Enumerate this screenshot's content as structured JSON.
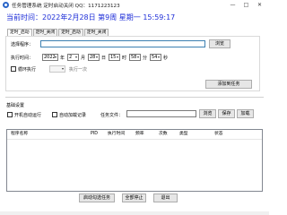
{
  "window": {
    "title": "任务管理系统 定时启动关闭 QQ：1171223123",
    "minimize_glyph": "—",
    "maximize_glyph": "□",
    "close_glyph": "✕"
  },
  "clock": {
    "text": "当前时间：2022年2月28日  第9周  星期一  15:59:17"
  },
  "tabs": [
    {
      "label": "定时_启动",
      "active": true
    },
    {
      "label": "定时_关闭",
      "active": false
    },
    {
      "label": "定时_启动",
      "active": false
    },
    {
      "label": "定时_关闭",
      "active": false
    }
  ],
  "start_tab": {
    "program_label": "选择程序：",
    "program_value": "",
    "browse_label": "浏览",
    "time_label": "执行时间：",
    "year": "2022",
    "year_unit": "年",
    "month": "2",
    "month_unit": "月",
    "day": "28",
    "day_unit": "日",
    "hour": "15",
    "hour_unit": "时",
    "minute": "58",
    "minute_unit": "分",
    "second": "54",
    "second_unit": "秒",
    "loop_label": "循环执行",
    "interval_value": "",
    "interval_suffix": "执行一次",
    "add_button": "添加到任务"
  },
  "settings": {
    "heading": "基础设置",
    "autorun_label": "开机自动运行",
    "autolog_label": "自动加载记录",
    "taskfile_label": "任务文件：",
    "taskfile_value": "",
    "browse_label": "浏览",
    "save_label": "保存",
    "load_label": "加载"
  },
  "table": {
    "columns": [
      "程序名称",
      "PID",
      "执行时间",
      "频率",
      "次数",
      "类型",
      "状态"
    ]
  },
  "footer": {
    "start_all": "启动勾选任务",
    "stop_all": "全部停止",
    "exit": "退出"
  }
}
